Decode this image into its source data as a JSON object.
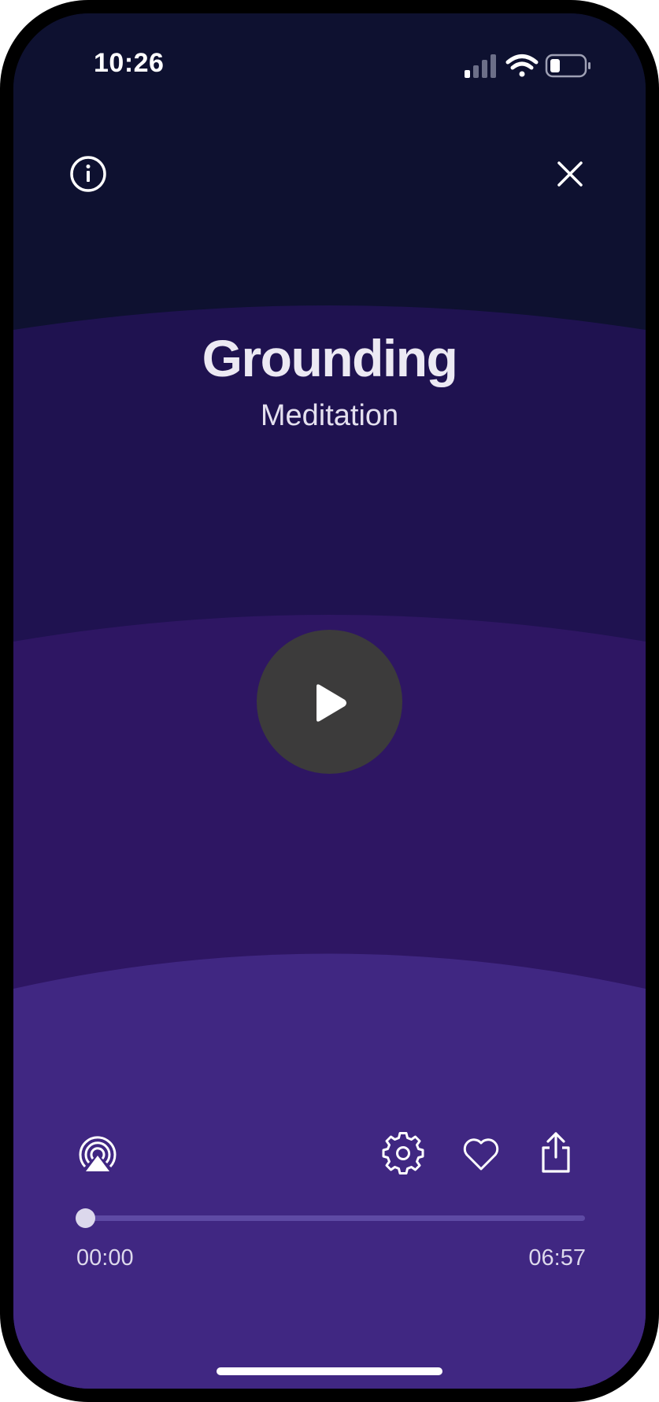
{
  "status_bar": {
    "time": "10:26"
  },
  "header": {
    "info_icon": "info-icon",
    "close_icon": "close-icon"
  },
  "session": {
    "title": "Grounding",
    "subtitle": "Meditation"
  },
  "player": {
    "play_icon": "play-icon",
    "elapsed": "00:00",
    "total": "06:57",
    "progress_fraction": 0.0
  },
  "controls": {
    "airplay_icon": "airplay-icon",
    "settings_icon": "gear-icon",
    "favorite_icon": "heart-icon",
    "share_icon": "share-icon"
  },
  "colors": {
    "background_top": "#0e1130",
    "band_1": "#1f1250",
    "band_2": "#2e1663",
    "band_3": "#402782",
    "play_button": "#3c3b3b",
    "progress_track": "#5e4aa4",
    "progress_thumb": "#dcd8ec",
    "text": "#ece9f3"
  }
}
